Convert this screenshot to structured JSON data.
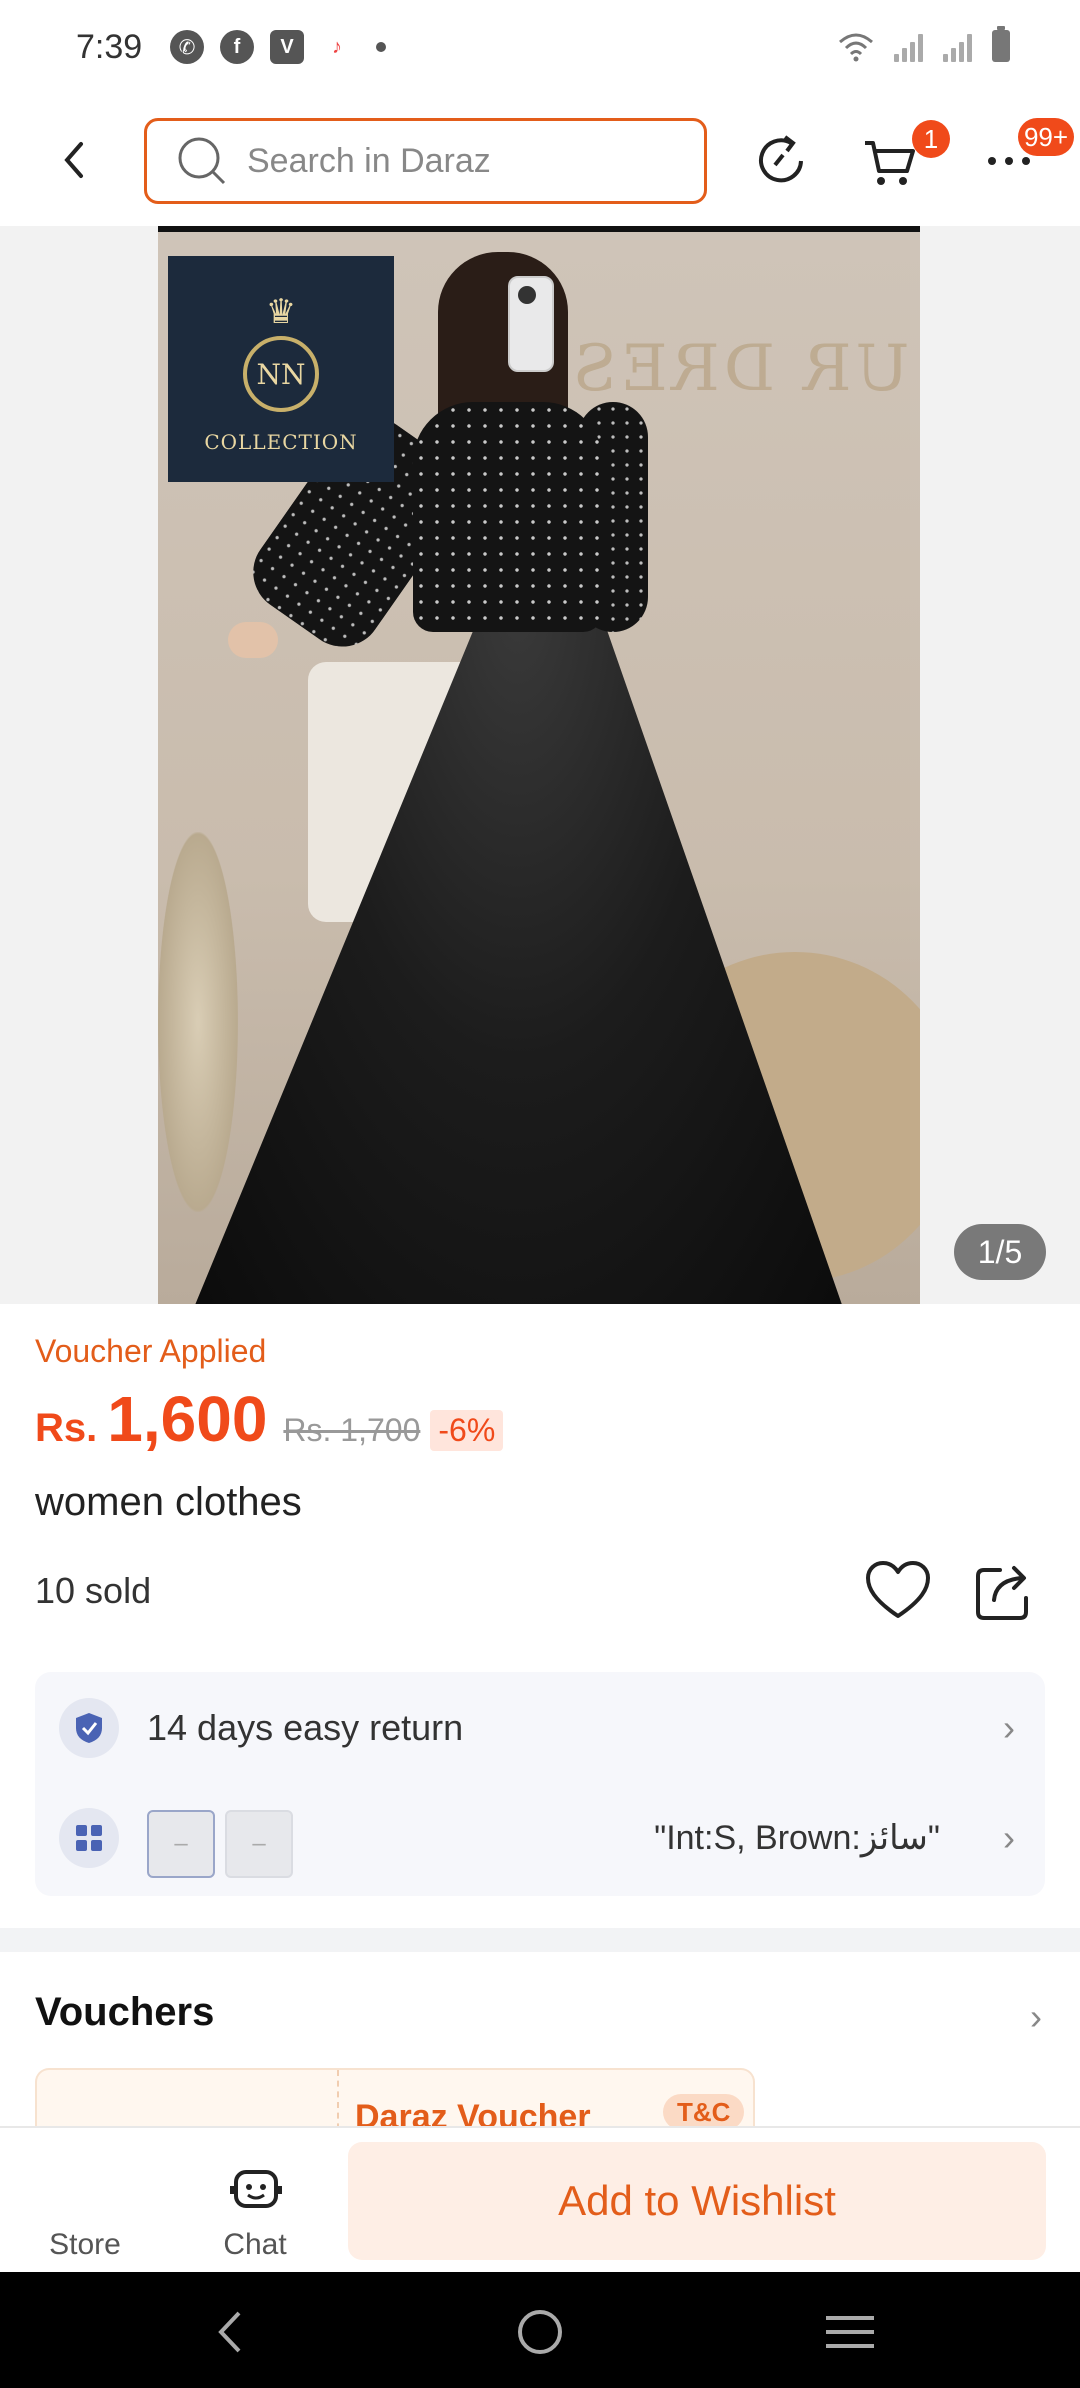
{
  "status_bar": {
    "time": "7:39",
    "app_icons": [
      "whatsapp-icon",
      "facebook-icon",
      "vimeo-icon",
      "tiktok-icon"
    ],
    "right_icons": [
      "wifi-icon",
      "signal-icon",
      "signal-icon",
      "battery-icon"
    ]
  },
  "header": {
    "search_placeholder": "Search in Daraz",
    "cart_badge": "1",
    "more_badge": "99+",
    "accent": "#e35d1a"
  },
  "gallery": {
    "counter": "1/5",
    "logo_initials": "NN",
    "logo_text": "COLLECTION",
    "wall_text": "UR DRES"
  },
  "product": {
    "voucher_applied": "Voucher Applied",
    "currency": "Rs.",
    "price": "1,600",
    "old_price": "Rs. 1,700",
    "discount": "-6%",
    "title": "women clothes",
    "sold": "10 sold"
  },
  "info": {
    "return_label": "14 days easy return",
    "variant_text": "\"Int:S, Brown:سائز\"",
    "variant_placeholder": "–"
  },
  "vouchers": {
    "heading": "Vouchers",
    "card_title": "Daraz Voucher",
    "tc_label": "T&C"
  },
  "action_bar": {
    "store_label": "Store",
    "chat_label": "Chat",
    "wishlist_label": "Add to Wishlist"
  }
}
